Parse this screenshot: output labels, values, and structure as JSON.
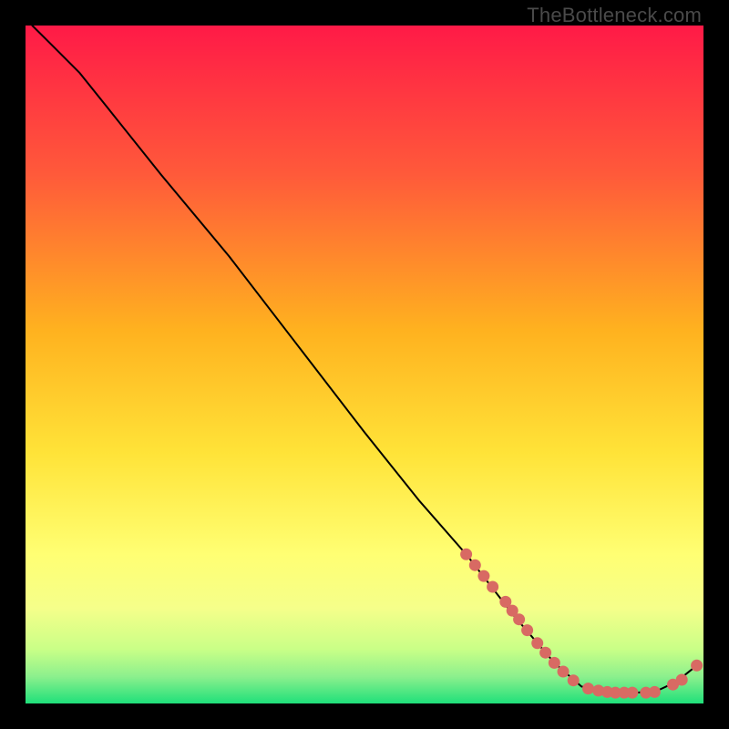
{
  "watermark": "TheBottleneck.com",
  "chart_data": {
    "type": "line",
    "title": "",
    "xlabel": "",
    "ylabel": "",
    "xlim": [
      0,
      100
    ],
    "ylim": [
      0,
      100
    ],
    "background_gradient": {
      "top": "#ff1a47",
      "mid1": "#ff7a2b",
      "mid2": "#ffd400",
      "mid3": "#ffff66",
      "mid4": "#d4ff66",
      "bottom": "#1fe07a"
    },
    "curve": [
      {
        "x": 1,
        "y": 100
      },
      {
        "x": 4,
        "y": 97
      },
      {
        "x": 8,
        "y": 93
      },
      {
        "x": 12,
        "y": 88
      },
      {
        "x": 20,
        "y": 78
      },
      {
        "x": 30,
        "y": 66
      },
      {
        "x": 40,
        "y": 53
      },
      {
        "x": 50,
        "y": 40
      },
      {
        "x": 58,
        "y": 30
      },
      {
        "x": 65,
        "y": 22
      },
      {
        "x": 72,
        "y": 13
      },
      {
        "x": 78,
        "y": 6
      },
      {
        "x": 82,
        "y": 2.5
      },
      {
        "x": 86,
        "y": 1.6
      },
      {
        "x": 90,
        "y": 1.6
      },
      {
        "x": 93,
        "y": 1.8
      },
      {
        "x": 96,
        "y": 3.2
      },
      {
        "x": 99,
        "y": 5.6
      }
    ],
    "markers": [
      {
        "x": 65.0,
        "y": 22.0
      },
      {
        "x": 66.3,
        "y": 20.4
      },
      {
        "x": 67.6,
        "y": 18.8
      },
      {
        "x": 68.9,
        "y": 17.2
      },
      {
        "x": 70.8,
        "y": 15.0
      },
      {
        "x": 71.8,
        "y": 13.7
      },
      {
        "x": 72.8,
        "y": 12.4
      },
      {
        "x": 74.0,
        "y": 10.8
      },
      {
        "x": 75.5,
        "y": 8.9
      },
      {
        "x": 76.7,
        "y": 7.5
      },
      {
        "x": 78.0,
        "y": 6.0
      },
      {
        "x": 79.3,
        "y": 4.7
      },
      {
        "x": 80.8,
        "y": 3.4
      },
      {
        "x": 83.0,
        "y": 2.2
      },
      {
        "x": 84.5,
        "y": 1.9
      },
      {
        "x": 85.8,
        "y": 1.7
      },
      {
        "x": 87.0,
        "y": 1.6
      },
      {
        "x": 88.3,
        "y": 1.6
      },
      {
        "x": 89.5,
        "y": 1.6
      },
      {
        "x": 91.5,
        "y": 1.6
      },
      {
        "x": 92.8,
        "y": 1.7
      },
      {
        "x": 95.5,
        "y": 2.8
      },
      {
        "x": 96.8,
        "y": 3.5
      },
      {
        "x": 99.0,
        "y": 5.6
      }
    ],
    "marker_color": "#d86a63",
    "curve_color": "#000000"
  }
}
